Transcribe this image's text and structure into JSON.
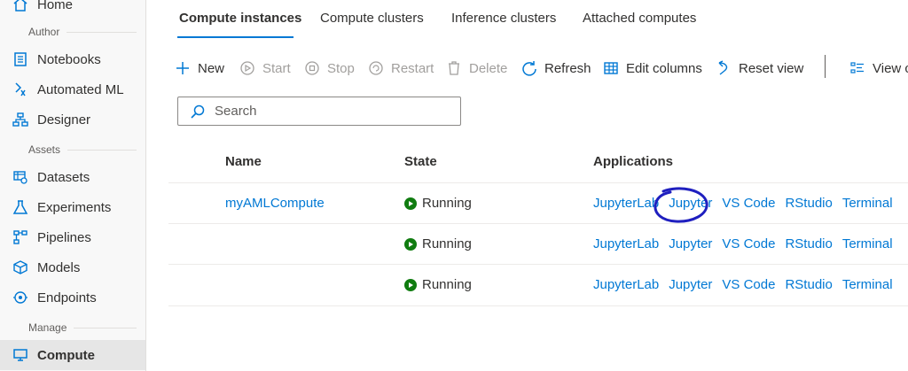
{
  "sidebar": {
    "items": [
      {
        "label": "Home",
        "icon": "home-icon"
      },
      {
        "label": "Notebooks",
        "icon": "notebook-icon"
      },
      {
        "label": "Automated ML",
        "icon": "automated-ml-icon"
      },
      {
        "label": "Designer",
        "icon": "designer-icon"
      },
      {
        "label": "Datasets",
        "icon": "datasets-icon"
      },
      {
        "label": "Experiments",
        "icon": "experiments-icon"
      },
      {
        "label": "Pipelines",
        "icon": "pipelines-icon"
      },
      {
        "label": "Models",
        "icon": "models-icon"
      },
      {
        "label": "Endpoints",
        "icon": "endpoints-icon"
      },
      {
        "label": "Compute",
        "icon": "compute-icon"
      }
    ],
    "sections": {
      "author": "Author",
      "assets": "Assets",
      "manage": "Manage"
    },
    "selected": "Compute"
  },
  "tabs": [
    {
      "label": "Compute instances",
      "active": true
    },
    {
      "label": "Compute clusters"
    },
    {
      "label": "Inference clusters"
    },
    {
      "label": "Attached computes"
    }
  ],
  "toolbar": {
    "new": "New",
    "start": "Start",
    "stop": "Stop",
    "restart": "Restart",
    "delete": "Delete",
    "refresh": "Refresh",
    "edit_columns": "Edit columns",
    "reset_view": "Reset view",
    "view": "View c"
  },
  "search": {
    "placeholder": "Search"
  },
  "table": {
    "headers": {
      "name": "Name",
      "state": "State",
      "applications": "Applications"
    },
    "rows": [
      {
        "name": "myAMLCompute",
        "state": "Running",
        "apps": [
          "JupyterLab",
          "Jupyter",
          "VS Code",
          "RStudio",
          "Terminal"
        ]
      },
      {
        "name": "",
        "state": "Running",
        "apps": [
          "JupyterLab",
          "Jupyter",
          "VS Code",
          "RStudio",
          "Terminal"
        ]
      },
      {
        "name": "",
        "state": "Running",
        "apps": [
          "JupyterLab",
          "Jupyter",
          "VS Code",
          "RStudio",
          "Terminal"
        ]
      }
    ]
  },
  "colors": {
    "accent": "#0078d4",
    "running": "#107c10",
    "annotation": "#1f1fbf"
  }
}
